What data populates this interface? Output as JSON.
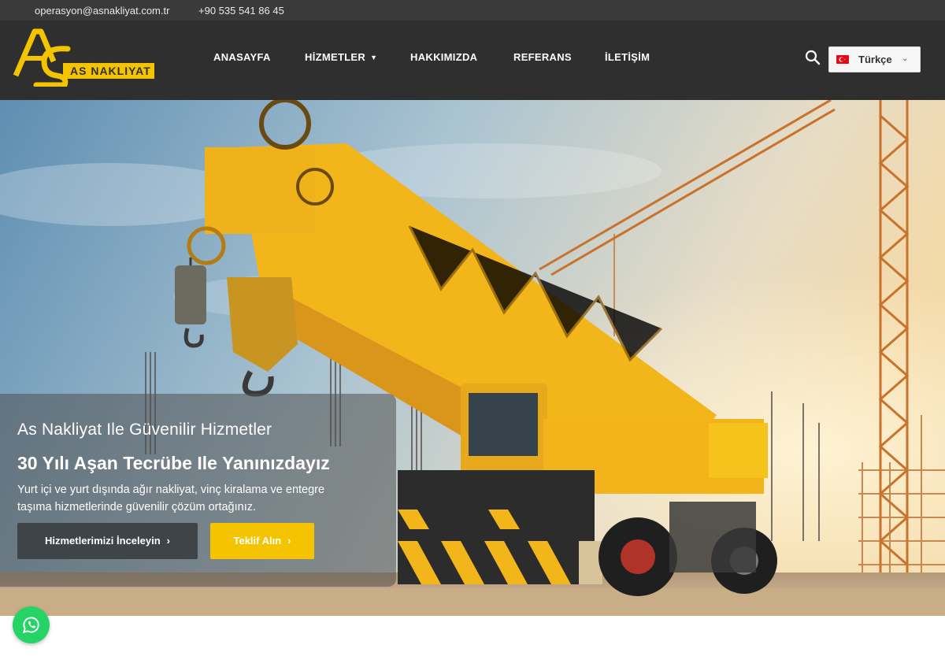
{
  "topbar": {
    "email": "operasyon@asnakliyat.com.tr",
    "phone": "+90 535 541 86 45"
  },
  "brand": {
    "logo_text": "AS NAKLIYAT",
    "accent_color": "#f4c400"
  },
  "nav": {
    "items": [
      {
        "label": "ANASAYFA"
      },
      {
        "label": "HİZMETLER",
        "has_dropdown": true
      },
      {
        "label": "HAKKIMIZDA"
      },
      {
        "label": "REFERANS"
      },
      {
        "label": "İLETİŞİM"
      }
    ],
    "search_icon": "search-icon",
    "language": {
      "label": "Türkçe",
      "flag": "turkey-flag-icon"
    }
  },
  "hero": {
    "kicker": "As Nakliyat Ile Güvenilir Hizmetler",
    "headline": "30 Yılı Aşan Tecrübe Ile Yanınızdayız",
    "description": "Yurt içi ve yurt dışında ağır nakliyat, vinç kiralama ve entegre taşıma hizmetlerinde güvenilir çözüm ortağınız.",
    "primary_button": "Hizmetlerimizi İnceleyin",
    "secondary_button": "Teklif Alın",
    "button_arrow": "›"
  },
  "floating": {
    "whatsapp_icon": "whatsapp-icon"
  }
}
